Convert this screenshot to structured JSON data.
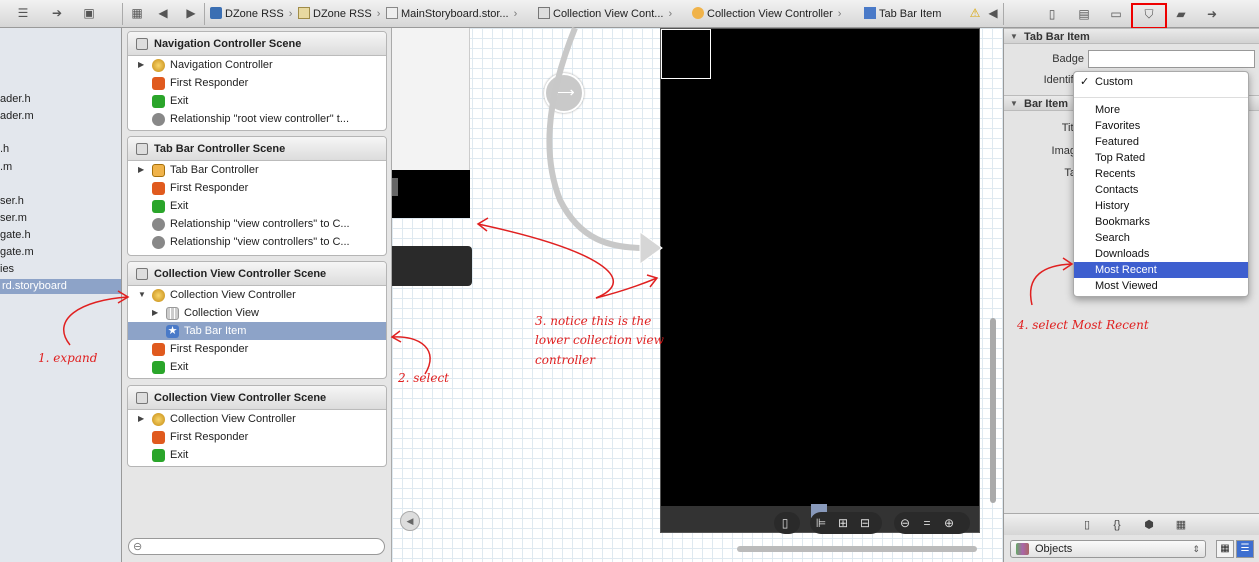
{
  "toolbar": {
    "crumbs": [
      "DZone RSS",
      "DZone RSS",
      "MainStoryboard.stor...",
      "Collection View Cont...",
      "Collection View Controller",
      "Tab Bar Item"
    ]
  },
  "navigator": {
    "items": [
      "ader.h",
      "ader.m",
      ".h",
      ".m",
      "ser.h",
      "ser.m",
      "gate.h",
      "gate.m",
      "ies",
      "rd.storyboard"
    ]
  },
  "outline": {
    "scenes": [
      {
        "title": "Navigation Controller Scene",
        "rows": [
          "Navigation Controller",
          "First Responder",
          "Exit",
          "Relationship \"root view controller\" t..."
        ]
      },
      {
        "title": "Tab Bar Controller Scene",
        "rows": [
          "Tab Bar Controller",
          "First Responder",
          "Exit",
          "Relationship \"view controllers\" to C...",
          "Relationship \"view controllers\" to C..."
        ]
      },
      {
        "title": "Collection View Controller Scene",
        "rows": [
          "Collection View Controller",
          "Collection View",
          "Tab Bar Item",
          "First Responder",
          "Exit"
        ]
      },
      {
        "title": "Collection View Controller Scene",
        "rows": [
          "Collection View Controller",
          "First Responder",
          "Exit"
        ]
      }
    ]
  },
  "inspector": {
    "section_tab_bar_item": "Tab Bar Item",
    "badge_label": "Badge",
    "identifier_label": "Identifi",
    "section_bar_item": "Bar Item",
    "title_label": "Titl",
    "image_label": "Imag",
    "tag_label": "Ta",
    "objects_label": "Objects"
  },
  "identifier_menu": {
    "items": [
      "Custom",
      "More",
      "Favorites",
      "Featured",
      "Top Rated",
      "Recents",
      "Contacts",
      "History",
      "Bookmarks",
      "Search",
      "Downloads",
      "Most Recent",
      "Most Viewed"
    ],
    "checked": "Custom",
    "highlighted": "Most Recent"
  },
  "annotations": {
    "step1": "1. expand",
    "step2": "2. select",
    "step3_l1": "3. notice this is the",
    "step3_l2": "lower collection view",
    "step3_l3": "controller",
    "step4": "4. select Most Recent",
    "color": "#e02020"
  }
}
